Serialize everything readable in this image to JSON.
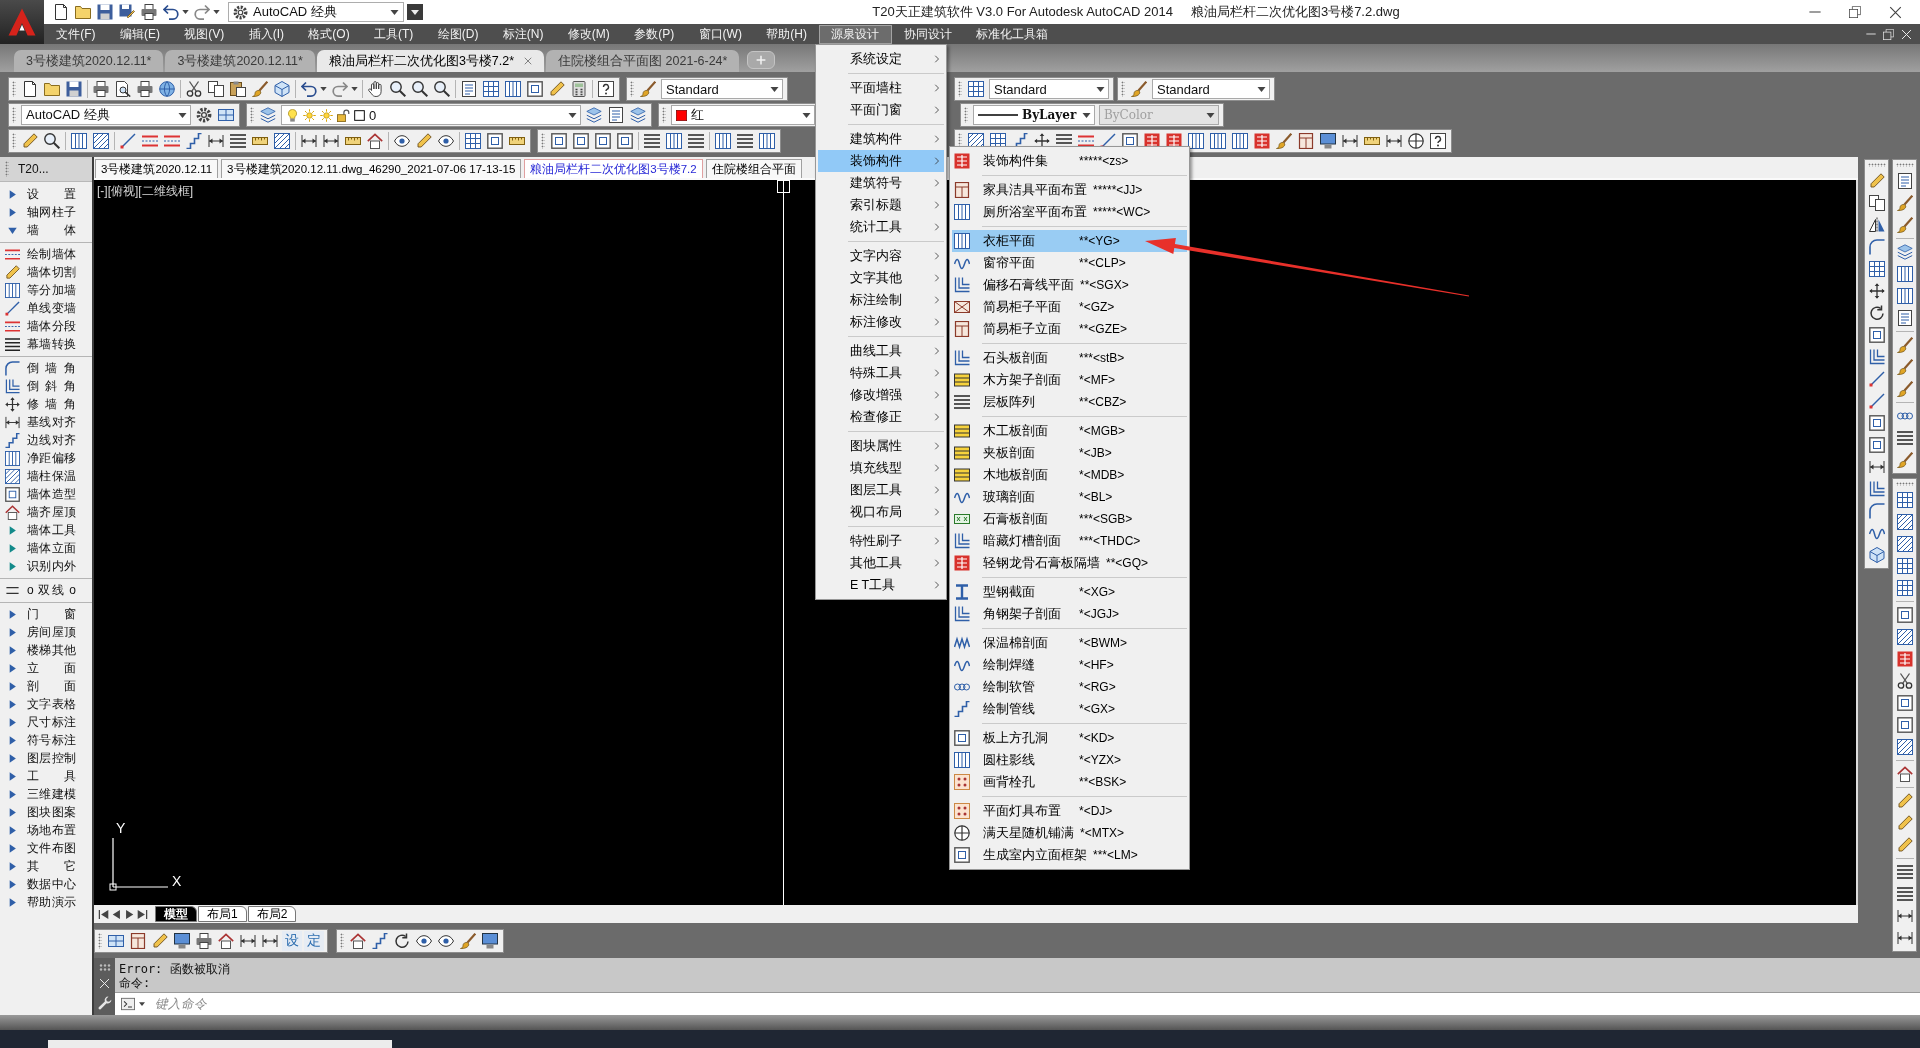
{
  "title_bar": {
    "workspace": "AutoCAD 经典",
    "app_title": "T20天正建筑软件 V3.0 For Autodesk AutoCAD 2014",
    "file_name": "粮油局栏杆二次优化图3号楼7.2.dwg"
  },
  "menu_bar": {
    "items": [
      {
        "label": "文件(F)",
        "selected": false
      },
      {
        "label": "编辑(E)",
        "selected": false
      },
      {
        "label": "视图(V)",
        "selected": false
      },
      {
        "label": "插入(I)",
        "selected": false
      },
      {
        "label": "格式(O)",
        "selected": false
      },
      {
        "label": "工具(T)",
        "selected": false
      },
      {
        "label": "绘图(D)",
        "selected": false
      },
      {
        "label": "标注(N)",
        "selected": false
      },
      {
        "label": "修改(M)",
        "selected": false
      },
      {
        "label": "参数(P)",
        "selected": false
      },
      {
        "label": "窗口(W)",
        "selected": false
      },
      {
        "label": "帮助(H)",
        "selected": false
      },
      {
        "label": "源泉设计",
        "selected": true
      },
      {
        "label": "协同设计",
        "selected": false
      },
      {
        "label": "标准化工具箱",
        "selected": false
      }
    ]
  },
  "dropdown_menu": {
    "groups": [
      [
        {
          "label": "系统设定",
          "selected": false
        }
      ],
      [
        {
          "label": "平面墙柱",
          "selected": false
        },
        {
          "label": "平面门窗",
          "selected": false
        }
      ],
      [
        {
          "label": "建筑构件",
          "selected": false
        },
        {
          "label": "装饰构件",
          "selected": true
        },
        {
          "label": "建筑符号",
          "selected": false
        },
        {
          "label": "索引标题",
          "selected": false
        },
        {
          "label": "统计工具",
          "selected": false
        }
      ],
      [
        {
          "label": "文字内容",
          "selected": false
        },
        {
          "label": "文字其他",
          "selected": false
        },
        {
          "label": "标注绘制",
          "selected": false
        },
        {
          "label": "标注修改",
          "selected": false
        }
      ],
      [
        {
          "label": "曲线工具",
          "selected": false
        },
        {
          "label": "特殊工具",
          "selected": false
        },
        {
          "label": "修改增强",
          "selected": false
        },
        {
          "label": "检查修正",
          "selected": false
        }
      ],
      [
        {
          "label": "图块属性",
          "selected": false
        },
        {
          "label": "填充线型",
          "selected": false
        },
        {
          "label": "图层工具",
          "selected": false
        },
        {
          "label": "视口布局",
          "selected": false
        }
      ],
      [
        {
          "label": "特性刷子",
          "selected": false
        },
        {
          "label": "其他工具",
          "selected": false
        },
        {
          "label": "E T工具",
          "selected": false
        }
      ]
    ]
  },
  "submenu": {
    "groups": [
      [
        {
          "label": "装饰构件集",
          "shortcut": "*****<zs>",
          "selected": false
        }
      ],
      [
        {
          "label": "家具洁具平面布置",
          "shortcut": "*****<JJ>",
          "selected": false
        },
        {
          "label": "厕所浴室平面布置",
          "shortcut": "*****<WC>",
          "selected": false
        }
      ],
      [
        {
          "label": "衣柜平面",
          "shortcut": "**<YG>",
          "selected": true
        },
        {
          "label": "窗帘平面",
          "shortcut": "**<CLP>",
          "selected": false
        },
        {
          "label": "偏移石膏线平面",
          "shortcut": "**<SGX>",
          "selected": false
        },
        {
          "label": "简易柜子平面",
          "shortcut": "*<GZ>",
          "selected": false
        },
        {
          "label": "简易柜子立面",
          "shortcut": "**<GZE>",
          "selected": false
        }
      ],
      [
        {
          "label": "石头板剖面",
          "shortcut": "***<stB>",
          "selected": false
        },
        {
          "label": "木方架子剖面",
          "shortcut": "*<MF>",
          "selected": false
        },
        {
          "label": "层板阵列",
          "shortcut": "**<CBZ>",
          "selected": false
        }
      ],
      [
        {
          "label": "木工板剖面",
          "shortcut": "*<MGB>",
          "selected": false
        },
        {
          "label": "夹板剖面",
          "shortcut": "*<JB>",
          "selected": false
        },
        {
          "label": "木地板剖面",
          "shortcut": "*<MDB>",
          "selected": false
        },
        {
          "label": "玻璃剖面",
          "shortcut": "*<BL>",
          "selected": false
        },
        {
          "label": "石膏板剖面",
          "shortcut": "***<SGB>",
          "selected": false
        },
        {
          "label": "暗藏灯槽剖面",
          "shortcut": "***<THDC>",
          "selected": false
        },
        {
          "label": "轻钢龙骨石膏板隔墙",
          "shortcut": "**<GQ>",
          "selected": false
        }
      ],
      [
        {
          "label": "型钢截面",
          "shortcut": "*<XG>",
          "selected": false
        },
        {
          "label": "角钢架子剖面",
          "shortcut": "*<JGJ>",
          "selected": false
        }
      ],
      [
        {
          "label": "保温棉剖面",
          "shortcut": "*<BWM>",
          "selected": false
        },
        {
          "label": "绘制焊缝",
          "shortcut": "*<HF>",
          "selected": false
        },
        {
          "label": "绘制软管",
          "shortcut": "*<RG>",
          "selected": false
        },
        {
          "label": "绘制管线",
          "shortcut": "*<GX>",
          "selected": false
        }
      ],
      [
        {
          "label": "板上方孔洞",
          "shortcut": "*<KD>",
          "selected": false
        },
        {
          "label": "圆柱影线",
          "shortcut": "*<YZX>",
          "selected": false
        },
        {
          "label": "画背栓孔",
          "shortcut": "**<BSK>",
          "selected": false
        }
      ],
      [
        {
          "label": "平面灯具布置",
          "shortcut": "*<DJ>",
          "selected": false
        },
        {
          "label": "满天星随机铺满",
          "shortcut": "*<MTX>",
          "selected": false
        },
        {
          "label": "生成室内立面框架",
          "shortcut": "***<LM>",
          "selected": false
        }
      ]
    ]
  },
  "file_tabs": [
    {
      "label": "3号楼建筑2020.12.11*",
      "selected": false
    },
    {
      "label": "3号楼建筑2020.12.11*",
      "selected": false
    },
    {
      "label": "粮油局栏杆二次优化图3号楼7.2*",
      "selected": true
    },
    {
      "label": "住院楼组合平面图 2021-6-24*",
      "selected": false
    }
  ],
  "toolbars": {
    "text_style": "Standard",
    "table_style": "Standard",
    "multileader_style": "Standard",
    "workspace": "AutoCAD 经典",
    "layer": "0",
    "color_name": "红",
    "linetype": "ByLayer",
    "plot_style": {
      "value": "ByColor",
      "disabled": true
    }
  },
  "left_panel": {
    "title": "T20...",
    "items": [
      {
        "kind": "folder",
        "label": "设 置",
        "expanded": false
      },
      {
        "kind": "folder",
        "label": "轴网柱子",
        "expanded": false
      },
      {
        "kind": "folder",
        "label": "墙 体",
        "expanded": true,
        "children": [
          {
            "kind": "separator"
          },
          {
            "kind": "command",
            "label": "绘制墙体"
          },
          {
            "kind": "command",
            "label": "墙体切割"
          },
          {
            "kind": "command",
            "label": "等分加墙"
          },
          {
            "kind": "command",
            "label": "单线变墙"
          },
          {
            "kind": "command",
            "label": "墙体分段"
          },
          {
            "kind": "command",
            "label": "幕墙转换"
          },
          {
            "kind": "separator"
          },
          {
            "kind": "command",
            "label": "倒 墙 角"
          },
          {
            "kind": "command",
            "label": "倒 斜 角"
          },
          {
            "kind": "command",
            "label": "修 墙 角"
          },
          {
            "kind": "command",
            "label": "基线对齐"
          },
          {
            "kind": "command",
            "label": "边线对齐"
          },
          {
            "kind": "command",
            "label": "净距偏移"
          },
          {
            "kind": "command",
            "label": "墙柱保温"
          },
          {
            "kind": "command",
            "label": "墙体造型"
          },
          {
            "kind": "command",
            "label": "墙齐屋顶"
          },
          {
            "kind": "submenu",
            "label": "墙体工具"
          },
          {
            "kind": "submenu",
            "label": "墙体立面"
          },
          {
            "kind": "submenu",
            "label": "识别内外"
          },
          {
            "kind": "separator"
          },
          {
            "kind": "toggle",
            "label": "o 双线 o"
          },
          {
            "kind": "separator"
          }
        ]
      },
      {
        "kind": "folder",
        "label": "门 窗",
        "expanded": false
      },
      {
        "kind": "folder",
        "label": "房间屋顶",
        "expanded": false
      },
      {
        "kind": "folder",
        "label": "楼梯其他",
        "expanded": false
      },
      {
        "kind": "folder",
        "label": "立 面",
        "expanded": false
      },
      {
        "kind": "folder",
        "label": "剖 面",
        "expanded": false
      },
      {
        "kind": "folder",
        "label": "文字表格",
        "expanded": false
      },
      {
        "kind": "folder",
        "label": "尺寸标注",
        "expanded": false
      },
      {
        "kind": "folder",
        "label": "符号标注",
        "expanded": false
      },
      {
        "kind": "folder",
        "label": "图层控制",
        "expanded": false
      },
      {
        "kind": "folder",
        "label": "工 具",
        "expanded": false
      },
      {
        "kind": "folder",
        "label": "三维建模",
        "expanded": false
      },
      {
        "kind": "folder",
        "label": "图块图案",
        "expanded": false
      },
      {
        "kind": "folder",
        "label": "场地布置",
        "expanded": false
      },
      {
        "kind": "folder",
        "label": "文件布图",
        "expanded": false
      },
      {
        "kind": "folder",
        "label": "其 它",
        "expanded": false
      },
      {
        "kind": "folder",
        "label": "数据中心",
        "expanded": false
      },
      {
        "kind": "folder",
        "label": "帮助演示",
        "expanded": false
      }
    ]
  },
  "drawing_tabs": [
    {
      "label": "3号楼建筑2020.12.11",
      "selected": false
    },
    {
      "label": "3号楼建筑2020.12.11.dwg_46290_2021-07-06 17-13-15",
      "selected": false
    },
    {
      "label": "粮油局栏杆二次优化图3号楼7.2",
      "selected": true
    },
    {
      "label": "住院楼组合平面",
      "selected": false
    }
  ],
  "viewport_label": "[-][俯视][二维线框]",
  "ucs_icon": {
    "x_axis": "X",
    "y_axis": "Y"
  },
  "layout_tabs": [
    {
      "label": "模型",
      "selected": true
    },
    {
      "label": "布局1",
      "selected": false
    },
    {
      "label": "布局2",
      "selected": false
    }
  ],
  "bottom_toolbar": {
    "text_buttons": [
      "设",
      "定"
    ]
  },
  "command_line": {
    "history": [
      "Error: 函数被取消",
      "命令:"
    ],
    "placeholder": "键入命令"
  }
}
